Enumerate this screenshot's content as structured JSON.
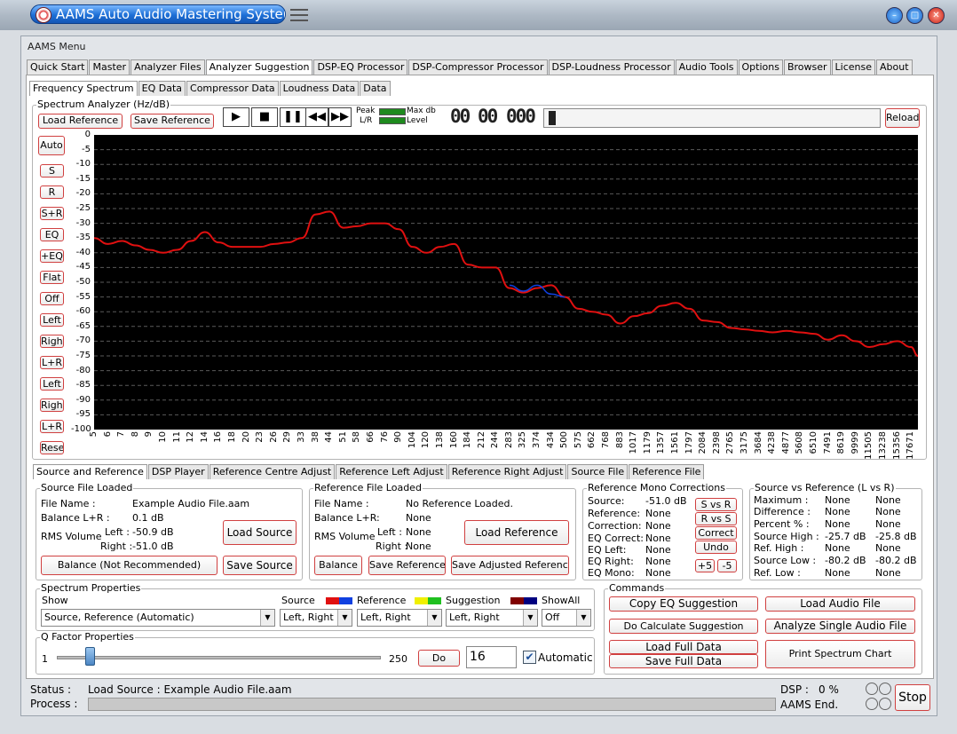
{
  "window": {
    "title": "AAMS Auto Audio Mastering System"
  },
  "menu_title": "AAMS Menu",
  "main_tabs": [
    "Quick Start",
    "Master",
    "Analyzer Files",
    "Analyzer Suggestion",
    "DSP-EQ Processor",
    "DSP-Compressor Processor",
    "DSP-Loudness Processor",
    "Audio Tools",
    "Options",
    "Browser",
    "License",
    "About"
  ],
  "sub_tabs": [
    "Frequency Spectrum",
    "EQ Data",
    "Compressor Data",
    "Loudness Data",
    "Data"
  ],
  "analyzer": {
    "title": "Spectrum Analyzer (Hz/dB)",
    "load_reference": "Load Reference",
    "save_reference": "Save Reference",
    "peak": "Peak",
    "lr": "L/R",
    "max_db": "Max db",
    "level": "Level",
    "counter": [
      "00",
      "00",
      "000"
    ],
    "reload": "Reload"
  },
  "side_buttons": [
    "Auto",
    "S",
    "R",
    "S+R",
    "EQ",
    "+EQ",
    "Flat",
    "Off",
    "Left",
    "Right",
    "L+R",
    "Left",
    "Right",
    "L+R",
    "Reset"
  ],
  "chart_data": {
    "type": "line",
    "ylim": [
      -100,
      0
    ],
    "y_ticks": [
      "0",
      "-5",
      "-10",
      "-15",
      "-20",
      "-25",
      "-30",
      "-35",
      "-40",
      "-45",
      "-50",
      "-55",
      "-60",
      "-65",
      "-70",
      "-75",
      "-80",
      "-85",
      "-90",
      "-95",
      "-100"
    ],
    "x_ticks": [
      "5",
      "6",
      "7",
      "8",
      "9",
      "10",
      "11",
      "12",
      "14",
      "16",
      "18",
      "20",
      "23",
      "26",
      "29",
      "33",
      "38",
      "44",
      "51",
      "58",
      "66",
      "76",
      "90",
      "104",
      "120",
      "138",
      "160",
      "184",
      "212",
      "244",
      "283",
      "325",
      "374",
      "434",
      "500",
      "575",
      "662",
      "768",
      "883",
      "1017",
      "1179",
      "1357",
      "1561",
      "1797",
      "2084",
      "2398",
      "2765",
      "3175",
      "3684",
      "4238",
      "4877",
      "5608",
      "6510",
      "7491",
      "8619",
      "9999",
      "11505",
      "13238",
      "15356",
      "17671"
    ],
    "series": [
      {
        "color": "#e01010",
        "x": [
          5,
          6,
          7,
          8,
          9,
          10,
          11,
          12,
          14,
          16,
          18,
          20,
          23,
          26,
          29,
          33,
          38,
          44,
          51,
          58,
          66,
          76,
          90,
          104,
          120,
          138,
          160,
          184,
          212,
          244,
          283,
          325,
          374,
          434,
          500,
          575,
          662,
          768,
          883,
          1017,
          1179,
          1357,
          1561,
          1797,
          2084,
          2398,
          2765,
          3175,
          3684,
          4238,
          4877,
          5608,
          6510,
          7491,
          8619,
          9999,
          11505,
          13238,
          15356,
          17671,
          20000
        ],
        "values": [
          -35,
          -37,
          -36,
          -37.5,
          -39,
          -40,
          -39,
          -36,
          -33,
          -36.5,
          -38,
          -38,
          -38,
          -37,
          -36.5,
          -35,
          -27,
          -26,
          -31.5,
          -31,
          -30,
          -30,
          -32,
          -38,
          -40,
          -38,
          -37,
          -44,
          -45,
          -45,
          -52,
          -53.5,
          -52,
          -51,
          -55,
          -59,
          -60,
          -61,
          -64,
          -61.5,
          -60.5,
          -58,
          -57,
          -59,
          -63,
          -63.5,
          -65.5,
          -66,
          -66.5,
          -67,
          -66.5,
          -67,
          -67.5,
          -69.5,
          -68,
          -70,
          -72,
          -71,
          -70,
          -72,
          -75
        ]
      },
      {
        "color": "#1040e0",
        "x": [
          283,
          325,
          374,
          434,
          500
        ],
        "values": [
          -51,
          -53,
          -51,
          -54,
          -55
        ]
      }
    ]
  },
  "lower_tabs": [
    "Source and Reference",
    "DSP Player",
    "Reference Centre Adjust",
    "Reference Left Adjust",
    "Reference Right Adjust",
    "Source File",
    "Reference File"
  ],
  "source": {
    "title": "Source File Loaded",
    "file_name_label": "File Name :",
    "file_name": "Example Audio File.aam",
    "balance_label": "Balance L+R :",
    "balance": "0.1 dB",
    "rms_label": "RMS Volume",
    "left_label": "Left :",
    "left": "-50.9 dB",
    "right_label": "Right :",
    "right": "-51.0 dB",
    "load_button": "Load Source",
    "balance_button": "Balance (Not Recommended)",
    "save_button": "Save Source"
  },
  "reference": {
    "title": "Reference File Loaded",
    "file_name_label": "File Name :",
    "file_name": "No Reference Loaded.",
    "balance_label": "Balance L+R:",
    "balance": "None",
    "rms_label": "RMS Volume",
    "left_label": "Left :",
    "left": "None",
    "right_label": "Right :",
    "right": "None",
    "load_button": "Load Reference",
    "balance_button": "Balance",
    "save_button": "Save Reference",
    "save_adjusted_button": "Save Adjusted Reference"
  },
  "mono": {
    "title": "Reference Mono Corrections",
    "rows": [
      {
        "label": "Source:",
        "value": "-51.0 dB"
      },
      {
        "label": "Reference:",
        "value": "None"
      },
      {
        "label": "Correction:",
        "value": "None"
      },
      {
        "label": "EQ Correct:",
        "value": "None"
      },
      {
        "label": "EQ Left:",
        "value": "None"
      },
      {
        "label": "EQ Right:",
        "value": "None"
      },
      {
        "label": "EQ Mono:",
        "value": "None"
      }
    ],
    "btn_svsr": "S vs R",
    "btn_rvss": "R vs S",
    "btn_correct": "Correct",
    "btn_undo": "Undo",
    "btn_plus5": "+5",
    "btn_minus5": "-5"
  },
  "svr": {
    "title": "Source vs Reference (L vs R)",
    "rows": [
      {
        "label": "Maximum :",
        "l": "None",
        "r": "None"
      },
      {
        "label": "Difference :",
        "l": "None",
        "r": "None"
      },
      {
        "label": "Percent % :",
        "l": "None",
        "r": "None"
      },
      {
        "label": "Source High :",
        "l": "-25.7 dB",
        "r": "-25.8 dB"
      },
      {
        "label": "Ref. High :",
        "l": "None",
        "r": "None"
      },
      {
        "label": "Source Low :",
        "l": "-80.2 dB",
        "r": "-80.2 dB"
      },
      {
        "label": "Ref. Low :",
        "l": "None",
        "r": "None"
      }
    ]
  },
  "spectrum_props": {
    "title": "Spectrum Properties",
    "show_label": "Show",
    "show_value": "Source, Reference (Automatic)",
    "source_label": "Source",
    "source_value": "Left, Right",
    "reference_label": "Reference",
    "reference_value": "Left, Right",
    "suggestion_label": "Suggestion",
    "suggestion_value": "Left, Right",
    "showall_label": "ShowAll",
    "showall_value": "Off",
    "colors": {
      "source": [
        "#e01010",
        "#1040e0"
      ],
      "reference": [
        "#f0f000",
        "#20c020"
      ],
      "suggestion": [
        "#800000",
        "#000080"
      ]
    }
  },
  "q_factor": {
    "title": "Q Factor Properties",
    "min": "1",
    "max": "250",
    "slider_value": 0.1,
    "do_button": "Do",
    "value": "16",
    "automatic_label": "Automatic",
    "automatic_checked": true
  },
  "commands": {
    "title": "Commands",
    "copy_eq": "Copy EQ Suggestion",
    "load_audio": "Load Audio File",
    "calc": "Do Calculate Suggestion",
    "analyze": "Analyze Single Audio File",
    "load_full": "Load Full Data",
    "save_full": "Save Full Data",
    "print": "Print Spectrum Chart"
  },
  "status": {
    "status_label": "Status :",
    "status_text": "Load Source : Example Audio File.aam",
    "process_label": "Process :",
    "dsp_label": "DSP :",
    "dsp_value": "0 %",
    "end_text": "AAMS End.",
    "stop_button": "Stop"
  }
}
